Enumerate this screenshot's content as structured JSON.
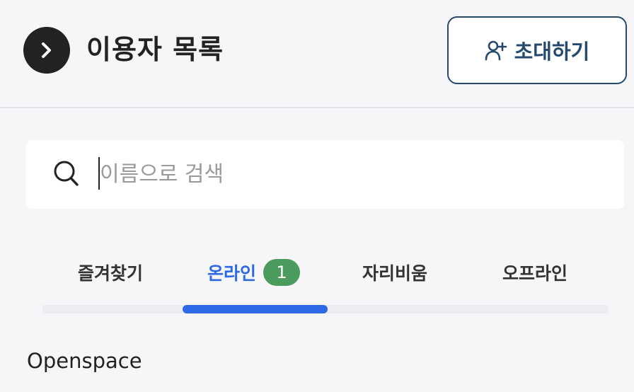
{
  "header": {
    "title": "이용자 목록",
    "invite_label": "초대하기"
  },
  "search": {
    "placeholder": "이름으로 검색",
    "value": ""
  },
  "tabs": [
    {
      "label": "즐겨찾기",
      "active": false
    },
    {
      "label": "온라인",
      "active": true,
      "badge": "1"
    },
    {
      "label": "자리비움",
      "active": false
    },
    {
      "label": "오프라인",
      "active": false
    }
  ],
  "section": {
    "title": "Openspace"
  },
  "colors": {
    "accent": "#2e6ae6",
    "button_border": "#254a6e",
    "badge": "#4b9a5e",
    "back_button": "#222222"
  },
  "icons": {
    "back": "chevron-right-icon",
    "invite": "user-plus-icon",
    "search": "search-icon"
  }
}
